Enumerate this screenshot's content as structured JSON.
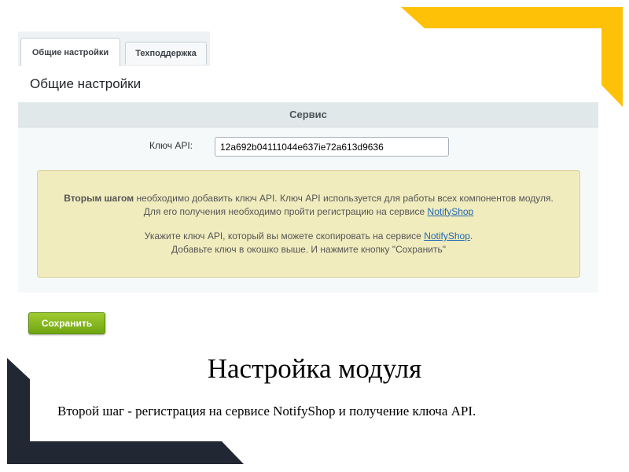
{
  "tabs": {
    "general_label": "Общие настройки",
    "support_label": "Техподдержка",
    "panel_title": "Общие настройки"
  },
  "service": {
    "header": "Сервис",
    "api_key_label": "Ключ API:",
    "api_key_value": "12a692b04111044e637ie72a613d9636"
  },
  "hint": {
    "p1_bold": "Вторым шагом",
    "p1_text": " необходимо добавить ключ API. Ключ API используется для работы всех компонентов модуля.",
    "p1_line2": "Для его получения необходимо пройти регистрацию на сервисе ",
    "p1_link": "NotifyShop",
    "p2_text": "Укажите ключ API, который вы можете скопировать на сервисе ",
    "p2_link": "NotifyShop",
    "p2_end": ".",
    "p2_line2": "Добавьте ключ в окошко выше. И нажмите кнопку \"Сохранить\""
  },
  "save_button_label": "Сохранить",
  "caption": {
    "title": "Настройка модуля",
    "text": "Второй шаг - регистрация на сервисе NotifyShop и получение ключа API."
  },
  "colors": {
    "accent_yellow": "#ffc107",
    "frame_dark": "#222833",
    "button_green": "#7cb518",
    "link_blue": "#2067b0"
  }
}
